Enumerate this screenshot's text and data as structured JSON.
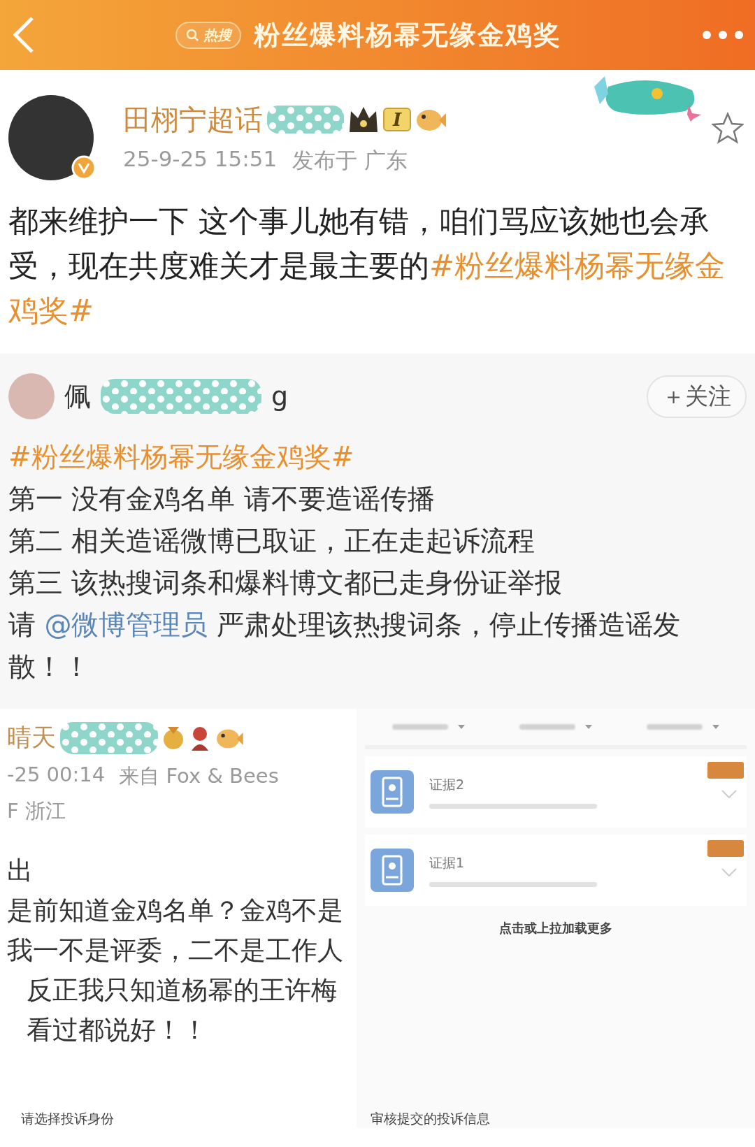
{
  "header": {
    "search_tag": "热搜",
    "title": "粉丝爆料杨幂无缘金鸡奖"
  },
  "post": {
    "author": "田栩宁超话",
    "level": "I",
    "time": "25-9-25 15:51",
    "location": "发布于 广东",
    "starred": false,
    "text": [
      {
        "kind": "text",
        "text": "都来维护一下 这个事儿她有错，咱们骂应该她也会承受，现在共度难关才是最主要的"
      },
      {
        "kind": "hashtag",
        "text": "#粉丝爆料杨幂无缘金鸡奖#"
      }
    ]
  },
  "quoted": {
    "author_prefix": "佩",
    "author_suffix": "g",
    "follow": "＋关注",
    "paragraphs": [
      [
        {
          "kind": "hashtag",
          "text": "#粉丝爆料杨幂无缘金鸡奖#"
        }
      ],
      [
        {
          "kind": "text",
          "text": "第一 没有金鸡名单 请不要造谣传播"
        }
      ],
      [
        {
          "kind": "text",
          "text": "第二 相关造谣微博已取证，正在走起诉流程"
        }
      ],
      [
        {
          "kind": "text",
          "text": "第三 该热搜词条和爆料博文都已走身份证举报"
        }
      ],
      [
        {
          "kind": "text",
          "text": "请 "
        },
        {
          "kind": "mention",
          "text": "@微博管理员"
        },
        {
          "kind": "text",
          "text": " 严肃处理该热搜词条，停止传播造谣发散！！"
        }
      ]
    ]
  },
  "comment": {
    "author": "晴天",
    "time": "-25 00:14",
    "source": "来自 Fox & Bees",
    "location": "F 浙江",
    "lines": [
      {
        "text": "出",
        "indent": false
      },
      {
        "text": "是前知道金鸡名单？金鸡不是",
        "indent": false
      },
      {
        "text": "我一不是评委，二不是工作人",
        "indent": false
      },
      {
        "text": "反正我只知道杨幂的王许梅",
        "indent": true
      },
      {
        "text": "看过都说好！！",
        "indent": true
      }
    ]
  },
  "evidence": {
    "items": [
      {
        "title": "证据2"
      },
      {
        "title": "证据1"
      }
    ],
    "load_more": "点击或上拉加载更多",
    "footer_left": "请选择投诉身份",
    "footer_right": "审核提交的投诉信息"
  }
}
